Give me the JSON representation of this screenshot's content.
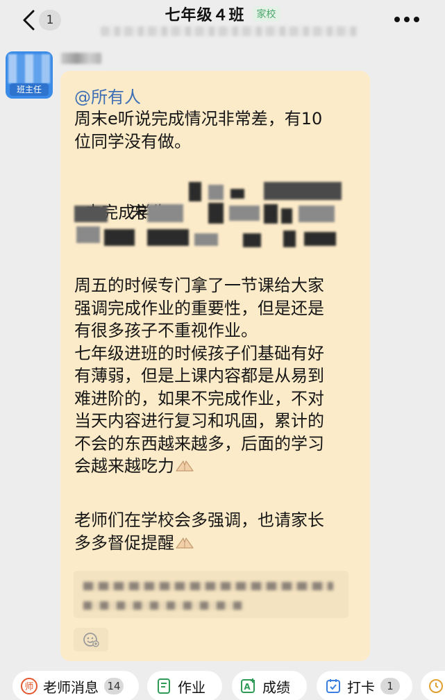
{
  "header": {
    "unread_count": "1",
    "title": "七年级４班",
    "tag": "家校"
  },
  "sender": {
    "avatar_label": "班主任"
  },
  "message": {
    "mention": "@所有人",
    "para1": "周末e听说完成情况非常差，有10\n位同学没有做。",
    "para2_label": "未完成学生：",
    "para2_visible_fragment": "宋",
    "para3": "周五的时候专门拿了一节课给大家\n强调完成作业的重要性，但是还是\n有很多孩子不重视作业。\n七年级进班的时候孩子们基础有好\n有薄弱，但是上课内容都是从易到\n难进阶的，如果不完成作业，不对\n当天内容进行复习和巩固，累计的\n不会的东西越来越多，后面的学习\n会越来越吃力",
    "para4": "老师们在学校会多强调，也请家长\n多多督促提醒"
  },
  "bottom_bar": {
    "teacher_messages": "老师消息",
    "teacher_messages_count": "14",
    "homework": "作业",
    "grades": "成绩",
    "checkin": "打卡",
    "checkin_count": "1"
  },
  "colors": {
    "bubble": "#fcebc9",
    "mention": "#3e6fb5",
    "tag_green": "#4aa66a",
    "avatar_blue": "#3a8be8",
    "teacher_icon": "#e2572d"
  },
  "icons": [
    "back-arrow-icon",
    "more-icon",
    "hand-emoji-icon",
    "emoji-icon",
    "teacher-icon",
    "homework-icon",
    "grades-icon",
    "checkin-icon"
  ]
}
